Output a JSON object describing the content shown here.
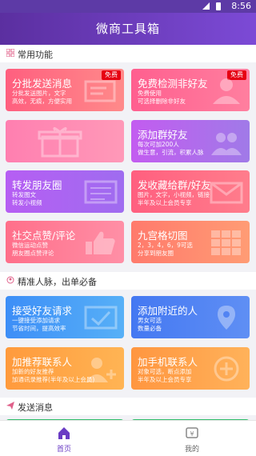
{
  "status": {
    "time": "8:56"
  },
  "header": {
    "title": "微商工具箱"
  },
  "sections": [
    {
      "label": "常用功能"
    },
    {
      "label": "精准人脉，出单必备"
    },
    {
      "label": "发送消息"
    }
  ],
  "cards": [
    {
      "title": "分批发送消息",
      "sub": "分批发送图片，文字\n高效，无痕，方便实用",
      "badge": "免费"
    },
    {
      "title": "免费检测非好友",
      "sub": "免费使用\n可选择删除非好友",
      "badge": "免费"
    },
    {
      "title": "",
      "sub": ""
    },
    {
      "title": "添加群好友",
      "sub": "每次可加200人\n做生意，引流，积累人脉"
    },
    {
      "title": "转发朋友圈",
      "sub": "转发图文\n转发小视频"
    },
    {
      "title": "发收藏给群/好友",
      "sub": "图片，文字，小视频，链接\n半年及以上会员专享"
    },
    {
      "title": "社交点赞/评论",
      "sub": "微信运动点赞\n朋友圈点赞评论"
    },
    {
      "title": "九宫格切图",
      "sub": "2，3，4，6，9可选\n分享到朋友圈"
    },
    {
      "title": "接受好友请求",
      "sub": "一键接受添加请求\n节省时间，提高效率"
    },
    {
      "title": "添加附近的人",
      "sub": "男女可选\n数量必备"
    },
    {
      "title": "加推荐联系人",
      "sub": "加新的好友推荐\n加通讯录推荐(半年及以上会员)"
    },
    {
      "title": "加手机联系人",
      "sub": "对象可选，断点添加\n半年及以上会员专享"
    }
  ],
  "nav": {
    "home": "首页",
    "mine": "我的"
  },
  "colors": {
    "accent": "#6a3cc4",
    "badge": "#e60012"
  }
}
